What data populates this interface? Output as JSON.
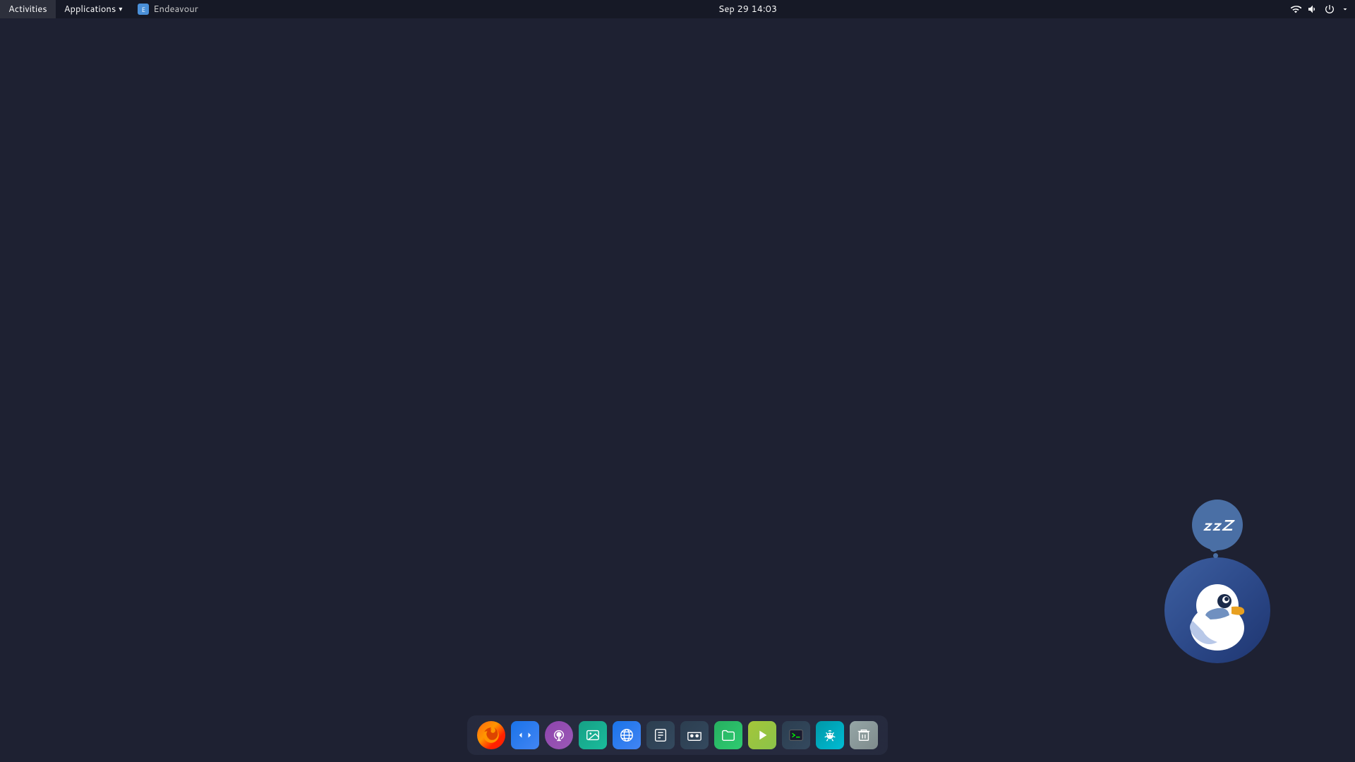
{
  "topbar": {
    "activities_label": "Activities",
    "applications_label": "Applications",
    "active_app_name": "Endeavour",
    "datetime": "Sep 29  14:03",
    "wifi_icon": "wifi",
    "volume_icon": "volume",
    "power_icon": "power"
  },
  "ddg": {
    "zzz_text": "zzZ"
  },
  "dock": {
    "items": [
      {
        "id": "firefox",
        "label": "Firefox",
        "icon_type": "firefox",
        "symbol": "🦊"
      },
      {
        "id": "remote-desktop",
        "label": "Remote Desktop",
        "icon_type": "blue",
        "symbol": "⇄"
      },
      {
        "id": "podcast",
        "label": "Podcast",
        "icon_type": "purple",
        "symbol": "🎙"
      },
      {
        "id": "gnome-photos",
        "label": "Photos",
        "icon_type": "teal",
        "symbol": "🖼"
      },
      {
        "id": "browser2",
        "label": "Browser",
        "icon_type": "blue",
        "symbol": "🌐"
      },
      {
        "id": "text-editor",
        "label": "Text Editor",
        "icon_type": "dark",
        "symbol": "📄"
      },
      {
        "id": "vr",
        "label": "VR / XR",
        "icon_type": "dark",
        "symbol": "👓"
      },
      {
        "id": "files",
        "label": "Files",
        "icon_type": "green",
        "symbol": "📁"
      },
      {
        "id": "google-play",
        "label": "Google Play",
        "icon_type": "lime",
        "symbol": "▶"
      },
      {
        "id": "terminal",
        "label": "Terminal",
        "icon_type": "dark",
        "symbol": "⬛"
      },
      {
        "id": "bug",
        "label": "Bugs / Issues",
        "icon_type": "cyan",
        "symbol": "🐛"
      },
      {
        "id": "trash",
        "label": "Trash",
        "icon_type": "gray",
        "symbol": "🗑"
      }
    ]
  }
}
